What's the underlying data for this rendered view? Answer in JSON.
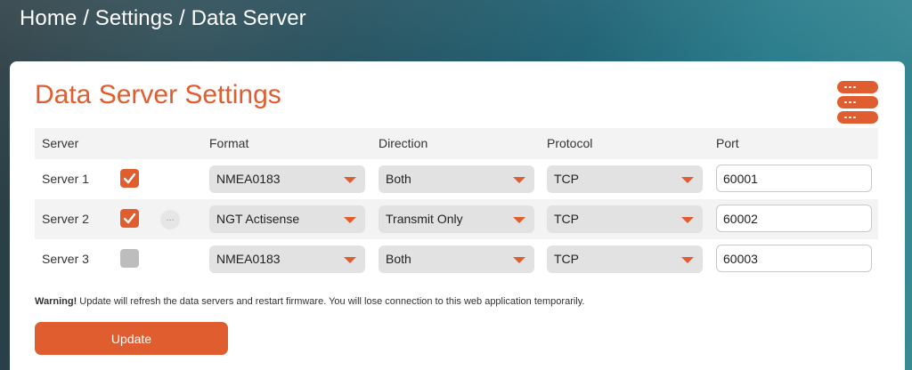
{
  "breadcrumb": {
    "home": "Home",
    "sep1": " / ",
    "settings": "Settings",
    "sep2": " / ",
    "current": "Data Server"
  },
  "page": {
    "title": "Data Server Settings"
  },
  "table": {
    "headers": {
      "server": "Server",
      "format": "Format",
      "direction": "Direction",
      "protocol": "Protocol",
      "port": "Port"
    },
    "rows": [
      {
        "label": "Server 1",
        "enabled": true,
        "format": "NMEA0183",
        "direction": "Both",
        "protocol": "TCP",
        "port": "60001"
      },
      {
        "label": "Server 2",
        "enabled": true,
        "more": "...",
        "format": "NGT Actisense",
        "direction": "Transmit Only",
        "protocol": "TCP",
        "port": "60002"
      },
      {
        "label": "Server 3",
        "enabled": false,
        "format": "NMEA0183",
        "direction": "Both",
        "protocol": "TCP",
        "port": "60003"
      }
    ]
  },
  "warning": {
    "label": "Warning!",
    "text": " Update will refresh the data servers and restart firmware. You will lose connection to this web application temporarily."
  },
  "update_label": "Update",
  "colors": {
    "accent": "#e05d2f",
    "disabled": "#bdbdbd"
  }
}
